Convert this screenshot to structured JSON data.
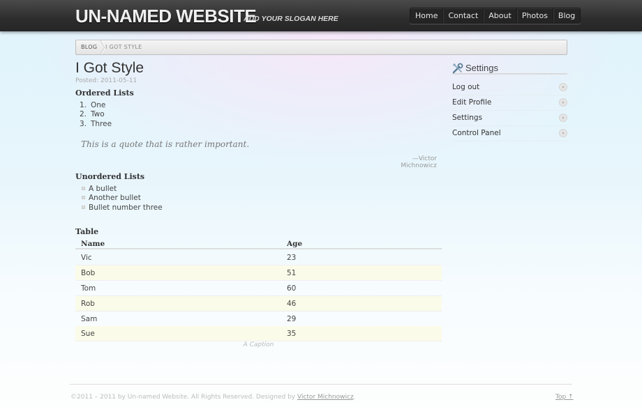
{
  "header": {
    "site_title": "UN-NAMED WEBSITE",
    "slogan": "ADD YOUR SLOGAN HERE",
    "nav": [
      "Home",
      "Contact",
      "About",
      "Photos",
      "Blog"
    ]
  },
  "breadcrumb": {
    "items": [
      "BLOG",
      "I GOT STYLE"
    ]
  },
  "post": {
    "title": "I Got Style",
    "posted": "Posted: 2011-05-11",
    "ordered_heading": "Ordered Lists",
    "ordered_items": [
      {
        "num": "1.",
        "label": "One"
      },
      {
        "num": "2.",
        "label": "Two"
      },
      {
        "num": "3.",
        "label": "Three"
      }
    ],
    "quote": "This is a quote that is rather important.",
    "quote_cite": "—Victor Michnowicz",
    "unordered_heading": "Unordered Lists",
    "unordered_items": [
      "A bullet",
      "Another bullet",
      "Bullet number three"
    ],
    "table_heading": "Table",
    "table": {
      "columns": [
        "Name",
        "Age"
      ],
      "rows": [
        [
          "Vic",
          "23"
        ],
        [
          "Bob",
          "51"
        ],
        [
          "Tom",
          "60"
        ],
        [
          "Rob",
          "46"
        ],
        [
          "Sam",
          "29"
        ],
        [
          "Sue",
          "35"
        ]
      ],
      "caption": "A Caption"
    }
  },
  "sidebar": {
    "title": "Settings",
    "icon": "tools-icon",
    "items": [
      "Log out",
      "Edit Profile",
      "Settings",
      "Control Panel"
    ]
  },
  "footer": {
    "text_prefix": "©2011 – 2011 by Un-named Website. All Rights Reserved. Designed by ",
    "designer": "Victor Michnowicz",
    "text_suffix": ".",
    "top_link": "Top ↑"
  }
}
